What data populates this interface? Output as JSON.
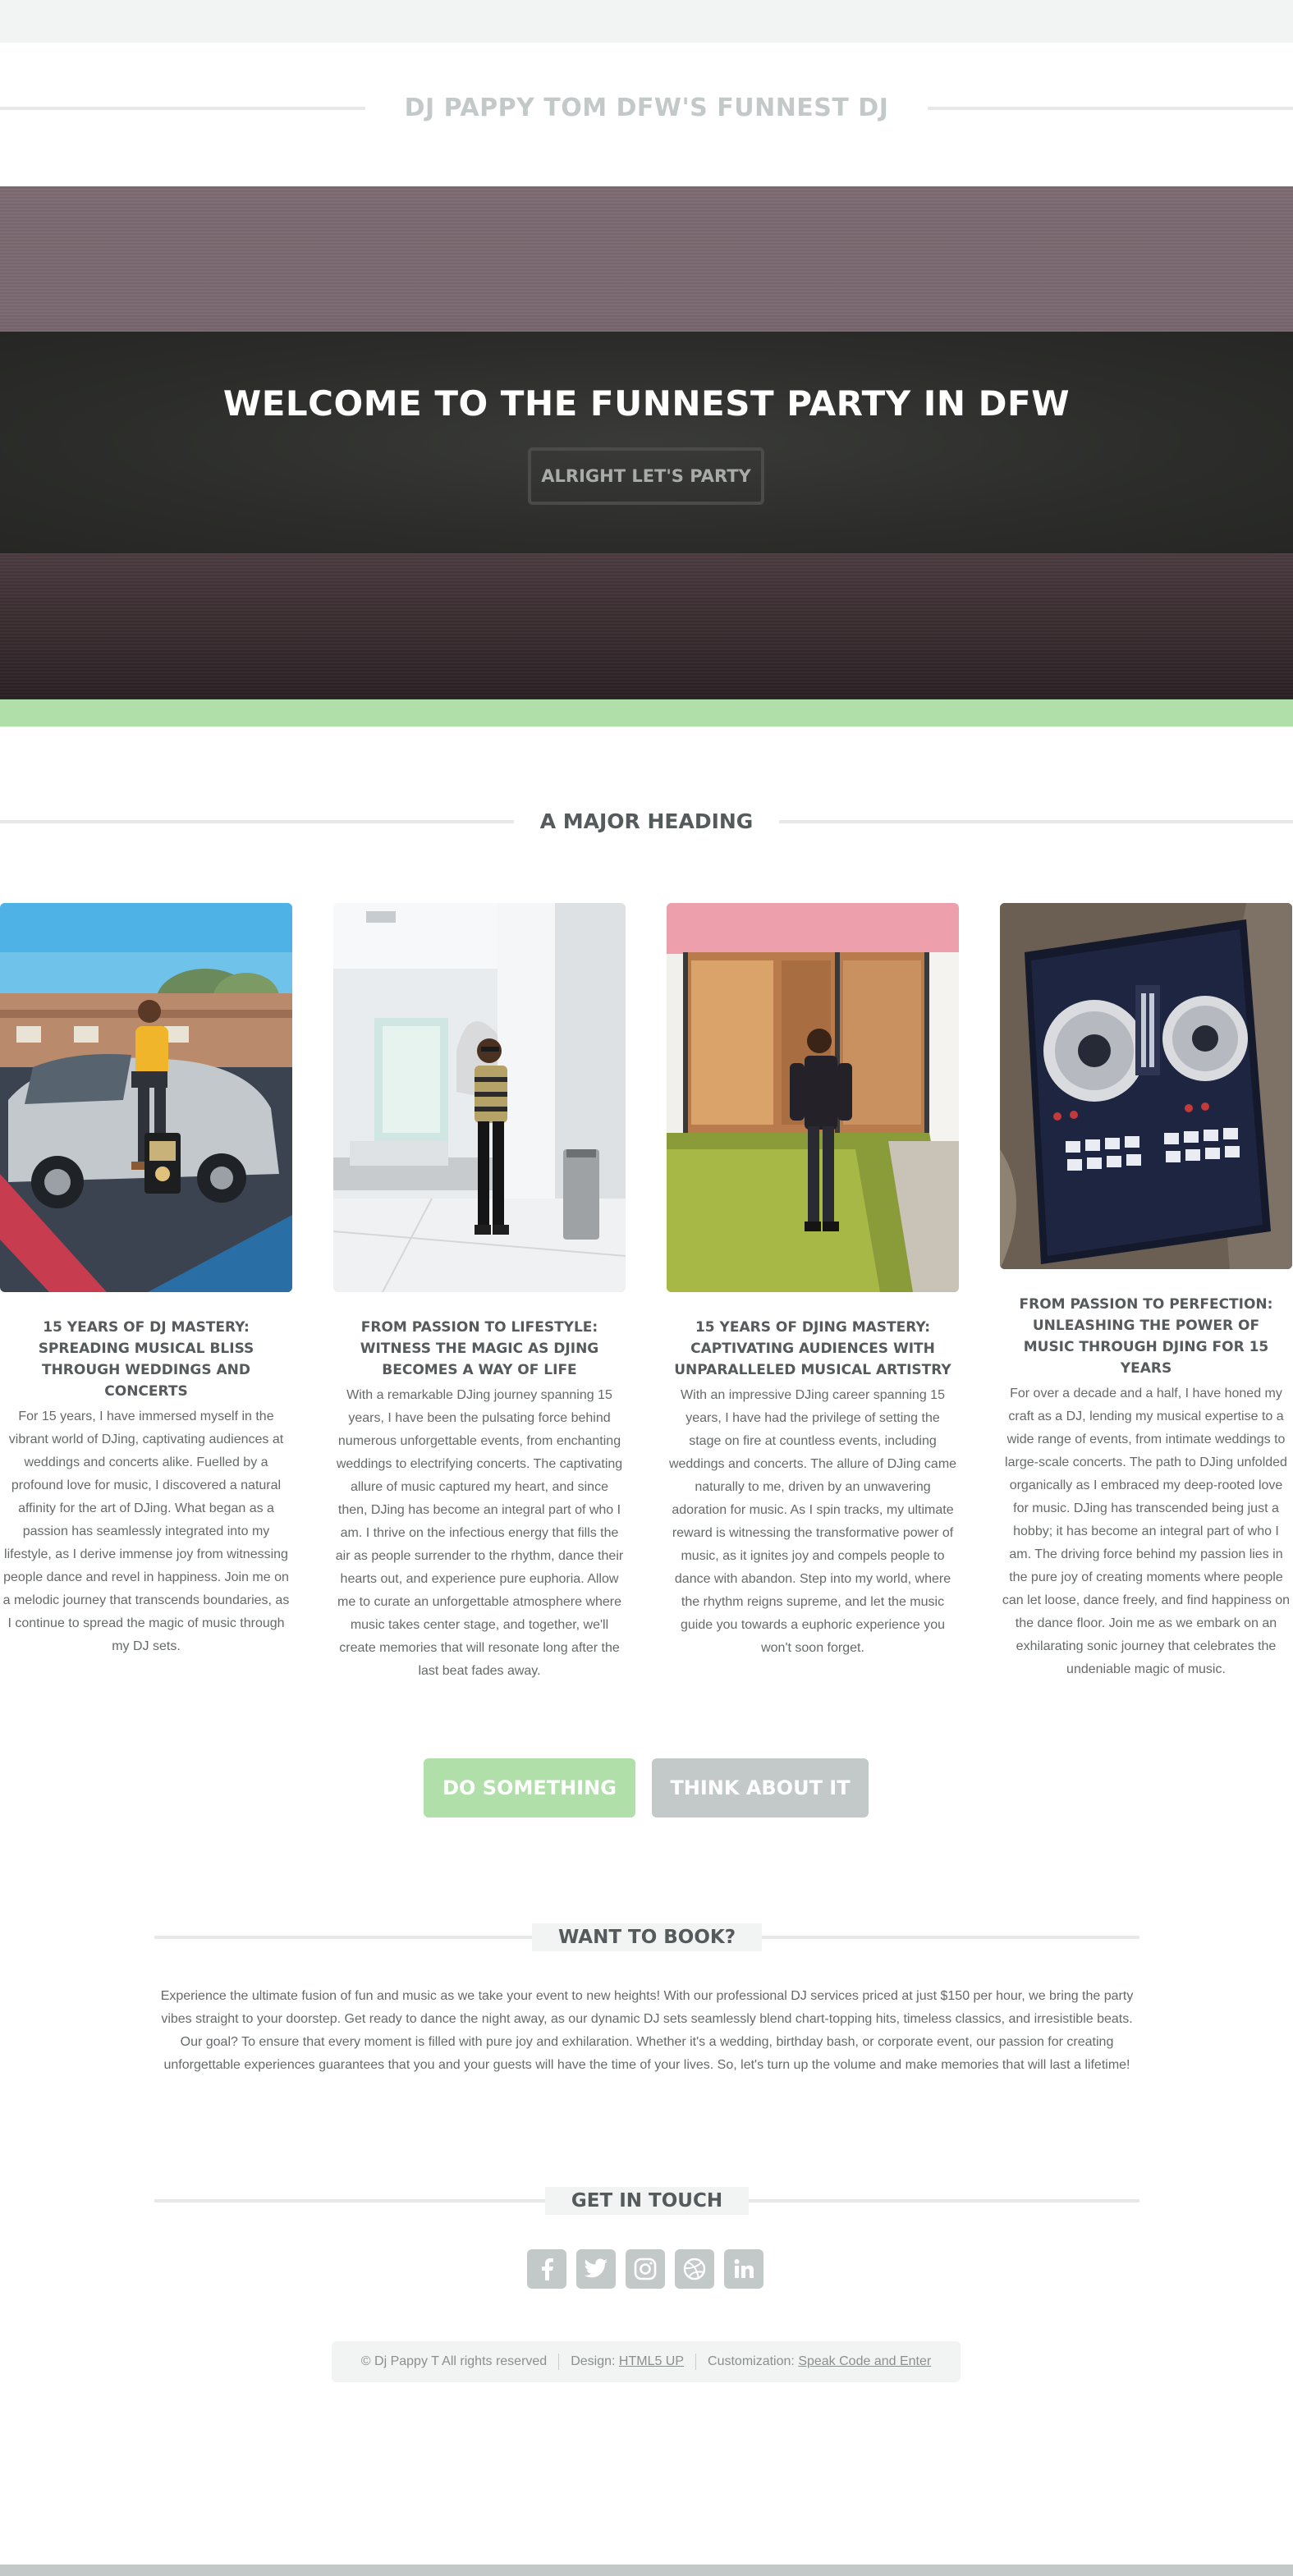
{
  "site": {
    "title": "DJ PAPPY TOM DFW'S FUNNEST DJ"
  },
  "banner": {
    "title": "WELCOME TO THE FUNNEST PARTY IN DFW",
    "button_label": "ALRIGHT LET'S PARTY"
  },
  "main": {
    "heading": "A MAJOR HEADING",
    "cards": [
      {
        "title": "15 YEARS OF DJ MASTERY: SPREADING MUSICAL BLISS THROUGH WEDDINGS AND CONCERTS",
        "text": "For 15 years, I have immersed myself in the vibrant world of DJing, captivating audiences at weddings and concerts alike. Fuelled by a profound love for music, I discovered a natural affinity for the art of DJing. What began as a passion has seamlessly integrated into my lifestyle, as I derive immense joy from witnessing people dance and revel in happiness. Join me on a melodic journey that transcends boundaries, as I continue to spread the magic of music through my DJ sets."
      },
      {
        "title": "FROM PASSION TO LIFESTYLE: WITNESS THE MAGIC AS DJING BECOMES A WAY OF LIFE",
        "text": "With a remarkable DJing journey spanning 15 years, I have been the pulsating force behind numerous unforgettable events, from enchanting weddings to electrifying concerts. The captivating allure of music captured my heart, and since then, DJing has become an integral part of who I am. I thrive on the infectious energy that fills the air as people surrender to the rhythm, dance their hearts out, and experience pure euphoria. Allow me to curate an unforgettable atmosphere where music takes center stage, and together, we'll create memories that will resonate long after the last beat fades away."
      },
      {
        "title": "15 YEARS OF DJING MASTERY: CAPTIVATING AUDIENCES WITH UNPARALLELED MUSICAL ARTISTRY",
        "text": "With an impressive DJing career spanning 15 years, I have had the privilege of setting the stage on fire at countless events, including weddings and concerts. The allure of DJing came naturally to me, driven by an unwavering adoration for music. As I spin tracks, my ultimate reward is witnessing the transformative power of music, as it ignites joy and compels people to dance with abandon. Step into my world, where the rhythm reigns supreme, and let the music guide you towards a euphoric experience you won't soon forget."
      },
      {
        "title": "FROM PASSION TO PERFECTION: UNLEASHING THE POWER OF MUSIC THROUGH DJING FOR 15 YEARS",
        "text": "For over a decade and a half, I have honed my craft as a DJ, lending my musical expertise to a wide range of events, from intimate weddings to large-scale concerts. The path to DJing unfolded organically as I embraced my deep-rooted love for music. DJing has transcended being just a hobby; it has become an integral part of who I am. The driving force behind my passion lies in the pure joy of creating moments where people can let loose, dance freely, and find happiness on the dance floor. Join me as we embark on an exhilarating sonic journey that celebrates the undeniable magic of music."
      }
    ],
    "actions": {
      "primary_label": "DO SOMETHING",
      "secondary_label": "THINK ABOUT IT"
    }
  },
  "book": {
    "heading": "WANT TO BOOK?",
    "text": "Experience the ultimate fusion of fun and music as we take your event to new heights! With our professional DJ services priced at just $150 per hour, we bring the party vibes straight to your doorstep. Get ready to dance the night away, as our dynamic DJ sets seamlessly blend chart-topping hits, timeless classics, and irresistible beats. Our goal? To ensure that every moment is filled with pure joy and exhilaration. Whether it's a wedding, birthday bash, or corporate event, our passion for creating unforgettable experiences guarantees that you and your guests will have the time of your lives. So, let's turn up the volume and make memories that will last a lifetime!"
  },
  "contact": {
    "heading": "GET IN TOUCH",
    "social": [
      "facebook-icon",
      "twitter-icon",
      "instagram-icon",
      "dribbble-icon",
      "linkedin-icon"
    ]
  },
  "footer": {
    "copyright": "© Dj Pappy T All rights reserved",
    "design_label": "Design:",
    "design_link": "HTML5 UP",
    "custom_label": "Customization:",
    "custom_link": "Speak Code and Enter"
  },
  "colors": {
    "accent": "#b1dfa9",
    "muted_button": "#c3c9c8",
    "text": "#555a5c"
  }
}
